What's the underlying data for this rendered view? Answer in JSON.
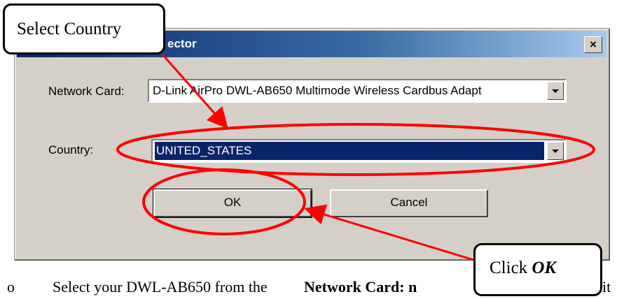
{
  "dialog": {
    "title": "ector",
    "close_label": "×",
    "network_card_label": "Network Card:",
    "network_card_value": "D-Link AirPro DWL-AB650 Multimode Wireless Cardbus Adapt",
    "country_label": "Country:",
    "country_value": "UNITED_STATES",
    "ok_label": "OK",
    "cancel_label": "Cancel"
  },
  "annotations": {
    "select_country": "Select Country",
    "click_ok_prefix": "Click ",
    "click_ok_emph": "OK",
    "highlight_color": "#ff0000"
  },
  "document": {
    "instruction_prefix": "Select your DWL-AB650 from the ",
    "instruction_bold": "Network Card: n",
    "instruction_tail": "it"
  }
}
